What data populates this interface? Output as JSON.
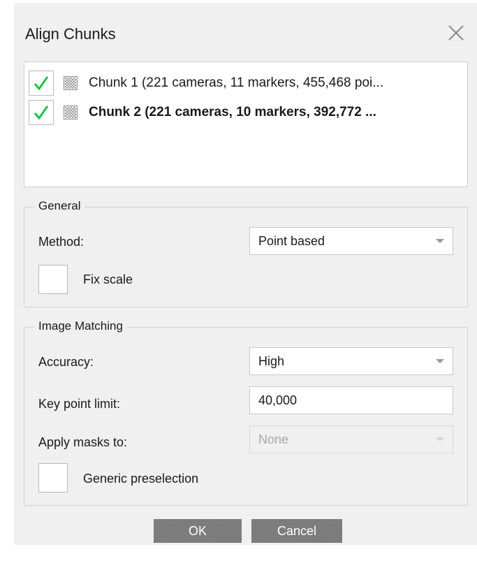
{
  "dialog": {
    "title": "Align Chunks",
    "close_icon": "close-icon"
  },
  "chunks": [
    {
      "label": "Chunk 1 (221 cameras, 11 markers, 455,468 poi...",
      "checked": true,
      "bold": false,
      "icon": "chunk-icon"
    },
    {
      "label": "Chunk 2 (221 cameras, 10 markers, 392,772 ...",
      "checked": true,
      "bold": true,
      "icon": "chunk-icon"
    }
  ],
  "general": {
    "title": "General",
    "method_label": "Method:",
    "method_value": "Point based",
    "fix_scale_label": "Fix scale",
    "fix_scale_checked": false
  },
  "image_matching": {
    "title": "Image Matching",
    "accuracy_label": "Accuracy:",
    "accuracy_value": "High",
    "keypoint_label": "Key point limit:",
    "keypoint_value": "40,000",
    "masks_label": "Apply masks to:",
    "masks_value": "None",
    "masks_enabled": false,
    "generic_label": "Generic preselection",
    "generic_checked": false
  },
  "buttons": {
    "ok_label": "OK",
    "cancel_label": "Cancel"
  },
  "colors": {
    "dialog_bg": "#f0f0f0",
    "check_green": "#19c34a",
    "button_gray": "#7a7a7a"
  }
}
